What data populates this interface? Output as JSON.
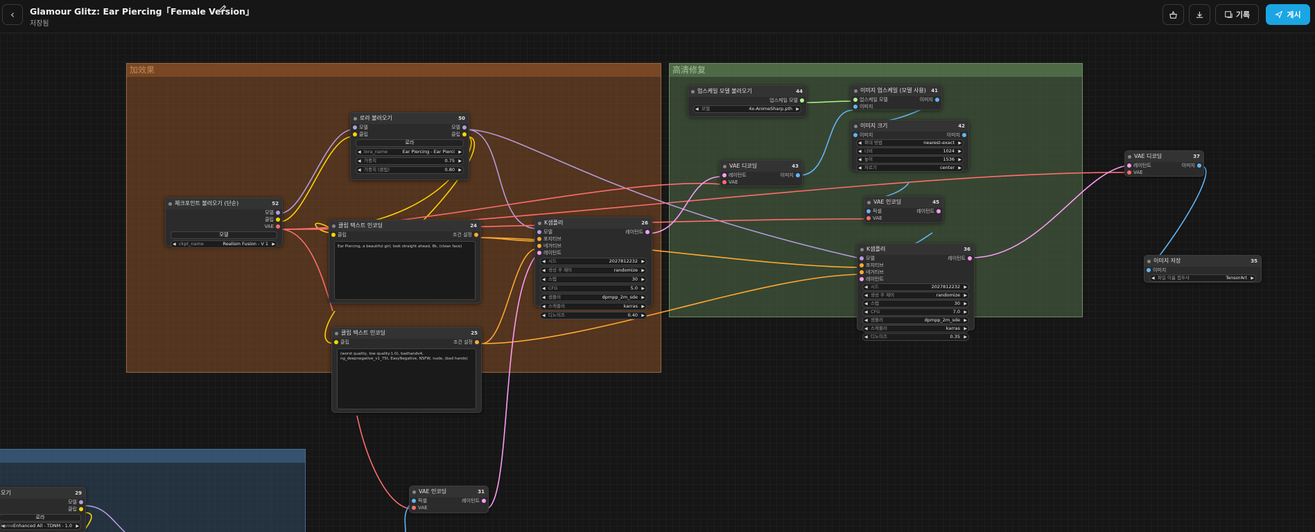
{
  "header": {
    "back_icon": "chevron-left-icon",
    "title": "Glamour Glitz: Ear Piercing「Female Version」",
    "status": "저장됨",
    "history_label": "기록",
    "publish_label": "게시"
  },
  "groups": [
    {
      "title": "加效果",
      "color": "#b16a3a"
    },
    {
      "title": "高清修复",
      "color": "#5a7a52"
    },
    {
      "title": "",
      "color": "#3a5a7a"
    }
  ],
  "nodes": {
    "n52": {
      "title": "체크포인트 불러오기 (단순)",
      "id": "52",
      "outputs": [
        "모델",
        "클립",
        "VAE"
      ],
      "button": "모델",
      "ckpt_label": "ckpt_name",
      "ckpt_value": "Realism Fusion - V 1"
    },
    "n50": {
      "title": "로라 불러오기",
      "id": "50",
      "inputs": [
        "모델",
        "클립"
      ],
      "outputs": [
        "모델",
        "클립"
      ],
      "button": "로라",
      "lora_label": "lora_name",
      "lora_value": "Ear Piercing - Ear Pierci",
      "w1_label": "가중치",
      "w1_value": "0.75",
      "w2_label": "가중치 (클립)",
      "w2_value": "0.80"
    },
    "n24": {
      "title": "클립 텍스트 인코딩",
      "id": "24",
      "input": "클립",
      "output": "조건 설정",
      "text": "Ear Piercing, a beautiful girl, look straight ahead, 8k, (clean face)"
    },
    "n25": {
      "title": "클립 텍스트 인코딩",
      "id": "25",
      "input": "클립",
      "output": "조건 설정",
      "text": "(worst quality, low quality:1.0), badhandv4, ng_deepnegative_v1_75t, EasyNegative, NSFW, nude, (bad hands)"
    },
    "n26": {
      "title": "K샘플러",
      "id": "26",
      "inputs": [
        "모델",
        "포지티브",
        "네거티브",
        "레이턴트"
      ],
      "output": "레이턴트",
      "widgets": [
        {
          "label": "시드",
          "value": "2027812232"
        },
        {
          "label": "생성 후 제어",
          "value": "randomize"
        },
        {
          "label": "스텝",
          "value": "30"
        },
        {
          "label": "CFG",
          "value": "5.0"
        },
        {
          "label": "샘플러",
          "value": "dpmpp_2m_sde"
        },
        {
          "label": "스케줄러",
          "value": "karras"
        },
        {
          "label": "디노이즈",
          "value": "0.40"
        }
      ]
    },
    "n31": {
      "title": "VAE 인코딩",
      "id": "31",
      "inputs": [
        "픽셀",
        "VAE"
      ],
      "output": "레이턴트"
    },
    "n44": {
      "title": "업스케일 모델 불러오기",
      "id": "44",
      "output": "업스케일 모델",
      "model_label": "모델",
      "model_value": "4x-AnimeSharp.pth"
    },
    "n41": {
      "title": "이미지 업스케일 (모델 사용)",
      "id": "41",
      "inputs": [
        "업스케일 모델",
        "이미지"
      ],
      "output": "이미지"
    },
    "n42": {
      "title": "이미지 크기",
      "id": "42",
      "input": "이미지",
      "output": "이미지",
      "widgets": [
        {
          "label": "확대 방법",
          "value": "nearest-exact"
        },
        {
          "label": "너비",
          "value": "1024"
        },
        {
          "label": "높이",
          "value": "1536"
        },
        {
          "label": "자르기",
          "value": "center"
        }
      ]
    },
    "n43": {
      "title": "VAE 디코딩",
      "id": "43",
      "inputs": [
        "레이턴트",
        "VAE"
      ],
      "output": "이미지"
    },
    "n45": {
      "title": "VAE 인코딩",
      "id": "45",
      "inputs": [
        "픽셀",
        "VAE"
      ],
      "output": "레이턴트"
    },
    "n36": {
      "title": "K샘플러",
      "id": "36",
      "inputs": [
        "모델",
        "포지티브",
        "네거티브",
        "레이턴트"
      ],
      "output": "레이턴트",
      "widgets": [
        {
          "label": "시드",
          "value": "2027812232"
        },
        {
          "label": "생성 후 제어",
          "value": "randomize"
        },
        {
          "label": "스텝",
          "value": "30"
        },
        {
          "label": "CFG",
          "value": "7.0"
        },
        {
          "label": "샘플러",
          "value": "dpmpp_2m_sde"
        },
        {
          "label": "스케줄러",
          "value": "karras"
        },
        {
          "label": "디노이즈",
          "value": "0.35"
        }
      ]
    },
    "n37": {
      "title": "VAE 디코딩",
      "id": "37",
      "inputs": [
        "레이턴트",
        "VAE"
      ],
      "output": "이미지"
    },
    "n35": {
      "title": "이미지 저장",
      "id": "35",
      "input": "이미지",
      "prefix_label": "파일 이름 접두사",
      "prefix_value": "TensorArt"
    },
    "n29": {
      "title": "오기",
      "id": "29",
      "outputs": [
        "모델",
        "클립"
      ],
      "button": "로라",
      "name_label": "name",
      "name_value": "Enhanced All - TDNM - 1.0"
    }
  },
  "link_colors": {
    "model": "#b39ddb",
    "clip": "#ffd500",
    "vae": "#ff6e6e",
    "conditioning": "#ffa931",
    "latent": "#ff9cf9",
    "image": "#64b5f6",
    "upscale_model": "#b2f78d"
  }
}
